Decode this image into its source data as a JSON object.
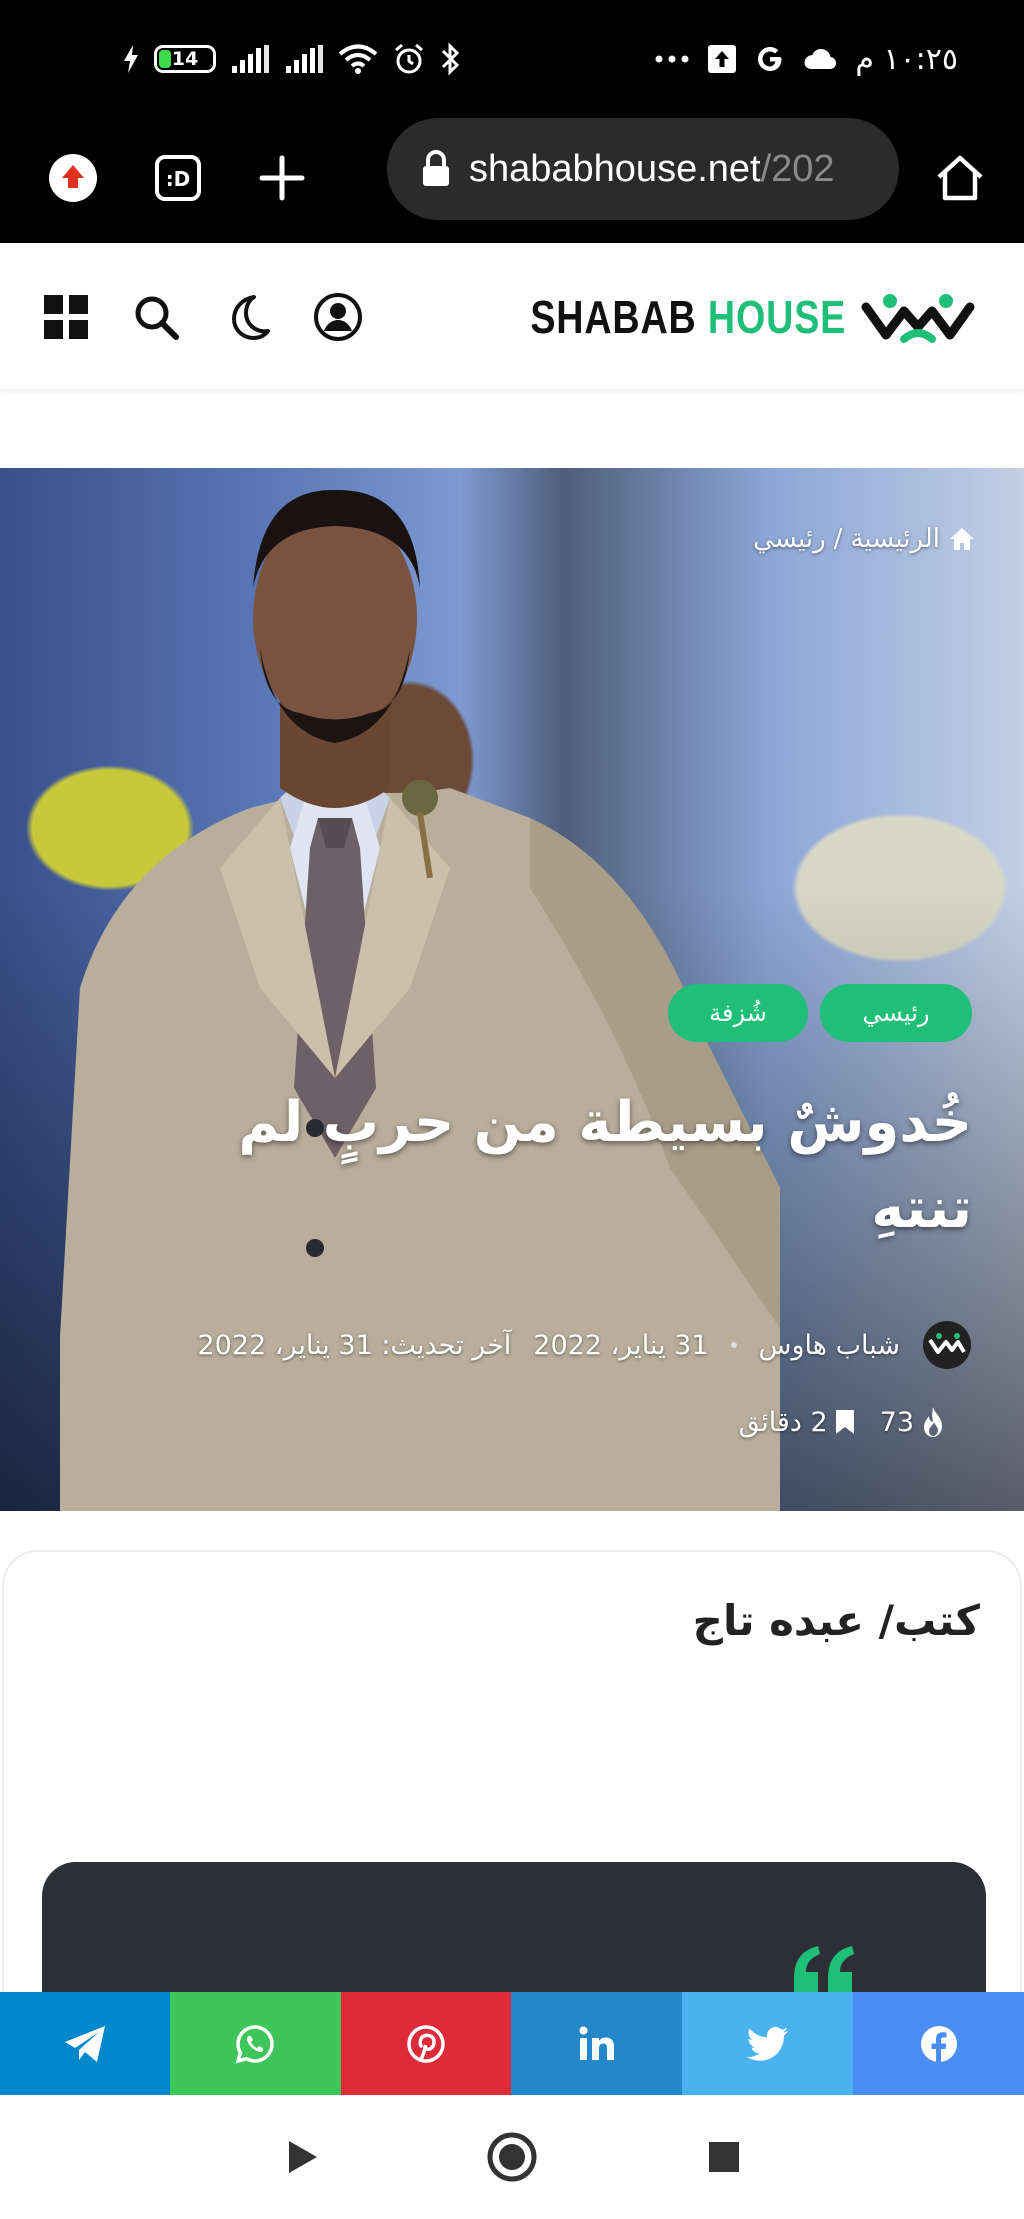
{
  "status_bar": {
    "time": "١٠:٢٥ م",
    "battery": "14"
  },
  "browser": {
    "url_main": "shababhouse.net",
    "url_rest": "/202"
  },
  "header": {
    "logo_part1": "SHABAB",
    "logo_part2": "HOUSE",
    "brand_color": "#1fbf7a"
  },
  "hero": {
    "breadcrumb_home": "الرئيسية",
    "breadcrumb_sep": "/",
    "breadcrumb_current": "رئيسي",
    "tags": [
      "رئيسي",
      "شُزفة"
    ],
    "title": "خُدوشٌ بسيطة من حربٍ لم تنتهِ",
    "author": "شباب هاوس",
    "date": "31 يناير، 2022",
    "updated": "آخر تحديث: 31 يناير، 2022",
    "views": "73",
    "read_time": "2 دقائق"
  },
  "article": {
    "byline": "كتب/ عبده تاج"
  },
  "share": {
    "colors": {
      "telegram": "#0088cc",
      "whatsapp": "#3ec65a",
      "pinterest": "#dd2b3a",
      "linkedin": "#2487c9",
      "twitter": "#4ab3ef",
      "facebook": "#4a8ef5"
    }
  }
}
